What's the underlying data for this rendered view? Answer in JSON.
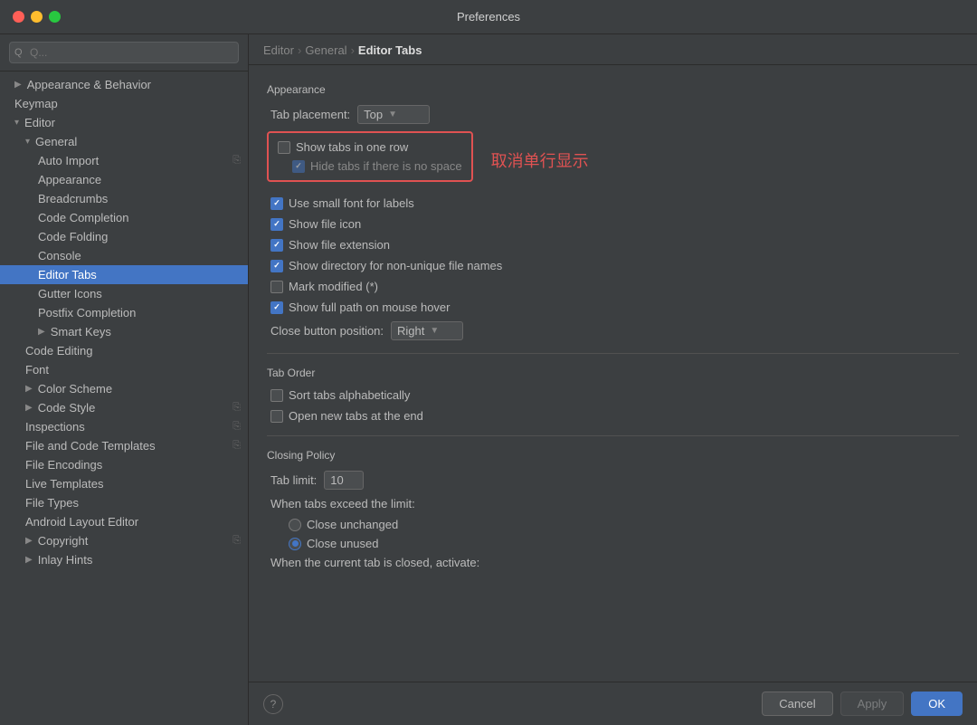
{
  "window": {
    "title": "Preferences"
  },
  "titlebar_buttons": {
    "close": "close",
    "minimize": "minimize",
    "maximize": "maximize"
  },
  "search": {
    "placeholder": "Q..."
  },
  "sidebar": {
    "items": [
      {
        "id": "appearance-behavior",
        "label": "Appearance & Behavior",
        "level": 0,
        "arrow": "▶",
        "indent": 0,
        "bold": true
      },
      {
        "id": "keymap",
        "label": "Keymap",
        "level": 0,
        "indent": 0
      },
      {
        "id": "editor",
        "label": "Editor",
        "level": 0,
        "arrow": "▾",
        "indent": 0,
        "bold": true
      },
      {
        "id": "general",
        "label": "General",
        "level": 1,
        "arrow": "▾",
        "indent": 1
      },
      {
        "id": "auto-import",
        "label": "Auto Import",
        "level": 2,
        "indent": 2
      },
      {
        "id": "appearance",
        "label": "Appearance",
        "level": 2,
        "indent": 2
      },
      {
        "id": "breadcrumbs",
        "label": "Breadcrumbs",
        "level": 2,
        "indent": 2
      },
      {
        "id": "code-completion",
        "label": "Code Completion",
        "level": 2,
        "indent": 2
      },
      {
        "id": "code-folding",
        "label": "Code Folding",
        "level": 2,
        "indent": 2
      },
      {
        "id": "console",
        "label": "Console",
        "level": 2,
        "indent": 2
      },
      {
        "id": "editor-tabs",
        "label": "Editor Tabs",
        "level": 2,
        "indent": 2,
        "selected": true
      },
      {
        "id": "gutter-icons",
        "label": "Gutter Icons",
        "level": 2,
        "indent": 2
      },
      {
        "id": "postfix-completion",
        "label": "Postfix Completion",
        "level": 2,
        "indent": 2
      },
      {
        "id": "smart-keys",
        "label": "Smart Keys",
        "level": 2,
        "arrow": "▶",
        "indent": 2
      },
      {
        "id": "code-editing",
        "label": "Code Editing",
        "level": 1,
        "indent": 1
      },
      {
        "id": "font",
        "label": "Font",
        "level": 1,
        "indent": 1
      },
      {
        "id": "color-scheme",
        "label": "Color Scheme",
        "level": 0,
        "arrow": "▶",
        "indent": 1
      },
      {
        "id": "code-style",
        "label": "Code Style",
        "level": 0,
        "arrow": "▶",
        "indent": 1,
        "has_copy": true
      },
      {
        "id": "inspections",
        "label": "Inspections",
        "level": 1,
        "indent": 1,
        "has_copy": true
      },
      {
        "id": "file-code-templates",
        "label": "File and Code Templates",
        "level": 1,
        "indent": 1,
        "has_copy": true
      },
      {
        "id": "file-encodings",
        "label": "File Encodings",
        "level": 1,
        "indent": 1
      },
      {
        "id": "live-templates",
        "label": "Live Templates",
        "level": 1,
        "indent": 1
      },
      {
        "id": "file-types",
        "label": "File Types",
        "level": 1,
        "indent": 1
      },
      {
        "id": "android-layout-editor",
        "label": "Android Layout Editor",
        "level": 1,
        "indent": 1
      },
      {
        "id": "copyright",
        "label": "Copyright",
        "level": 0,
        "arrow": "▶",
        "indent": 1,
        "has_copy": true
      },
      {
        "id": "inlay-hints",
        "label": "Inlay Hints",
        "level": 0,
        "arrow": "▶",
        "indent": 1
      }
    ]
  },
  "breadcrumb": {
    "parts": [
      "Editor",
      "General",
      "Editor Tabs"
    ]
  },
  "content": {
    "sections": {
      "appearance": {
        "title": "Appearance",
        "tab_placement_label": "Tab placement:",
        "tab_placement_value": "Top",
        "show_tabs_in_one_row": "Show tabs in one row",
        "hide_tabs_if_no_space": "Hide tabs if there is no space",
        "annotation": "取消单行显示",
        "use_small_font": "Use small font for labels",
        "show_file_icon": "Show file icon",
        "show_file_extension": "Show file extension",
        "show_directory": "Show directory for non-unique file names",
        "mark_modified": "Mark modified (*)",
        "show_full_path": "Show full path on mouse hover",
        "close_button_label": "Close button position:",
        "close_button_value": "Right"
      },
      "tab_order": {
        "title": "Tab Order",
        "sort_alphabetically": "Sort tabs alphabetically",
        "open_new_at_end": "Open new tabs at the end"
      },
      "closing_policy": {
        "title": "Closing Policy",
        "tab_limit_label": "Tab limit:",
        "tab_limit_value": "10",
        "when_exceed_label": "When tabs exceed the limit:",
        "close_unchanged": "Close unchanged",
        "close_unused": "Close unused",
        "when_current_closed": "When the current tab is closed, activate:"
      }
    }
  },
  "bottom": {
    "help_label": "?",
    "cancel_label": "Cancel",
    "apply_label": "Apply",
    "ok_label": "OK"
  }
}
